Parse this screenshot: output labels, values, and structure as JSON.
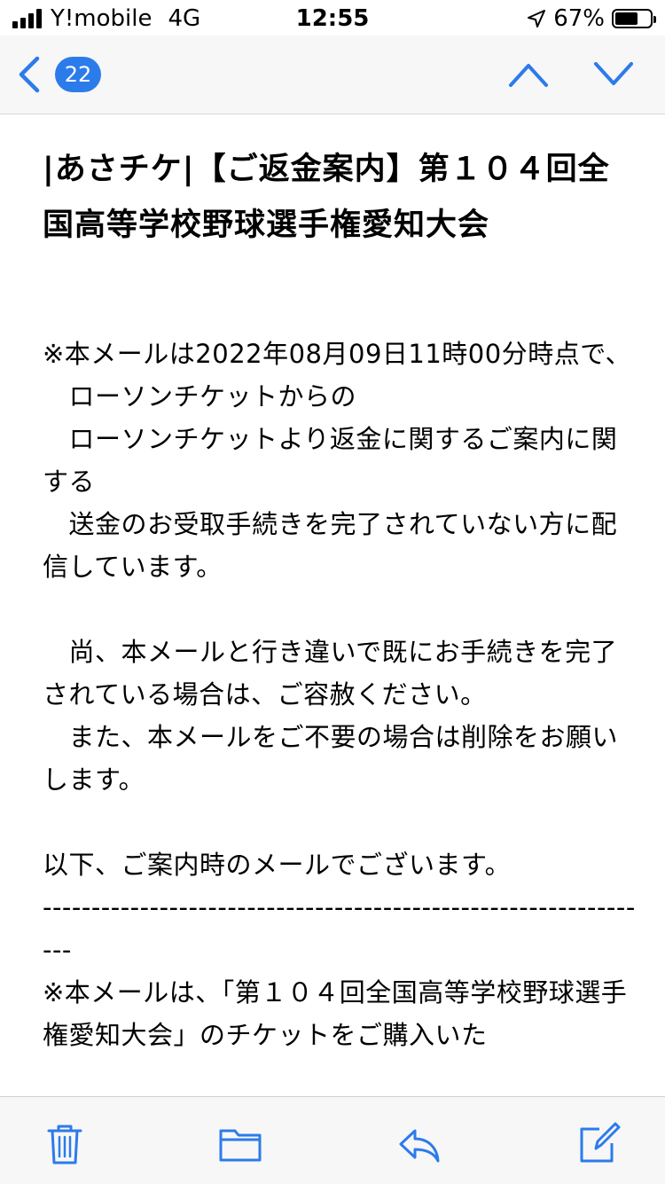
{
  "status_bar": {
    "carrier": "Y!mobile",
    "network": "4G",
    "time": "12:55",
    "battery": "67%",
    "battery_level": 0.67
  },
  "nav": {
    "unread_count": "22"
  },
  "email": {
    "subject": "|あさチケ|【ご返金案内】第１０４回全国高等学校野球選手権愛知大会",
    "body": "※本メールは2022年08月09日11時00分時点で、\n　ローソンチケットからの\n　ローソンチケットより返金に関するご案内に関する\n　送金のお受取手続きを完了されていない方に配信しています。\n\n　尚、本メールと行き違いで既にお手続きを完了されている場合は、ご容赦ください。\n　また、本メールをご不要の場合は削除をお願いします。\n\n以下、ご案内時のメールでございます。\n----------------------------------------------------------------\n※本メールは、「第１０４回全国高等学校野球選手権愛知大会」のチケットをご購入いた"
  },
  "colors": {
    "accent": "#2c7bea",
    "bar_bg": "#f7f7f7"
  },
  "icons": {
    "back": "chevron-left-icon",
    "prev": "chevron-up-icon",
    "next": "chevron-down-icon",
    "trash": "trash-icon",
    "folder": "folder-icon",
    "reply": "reply-icon",
    "compose": "compose-icon"
  }
}
